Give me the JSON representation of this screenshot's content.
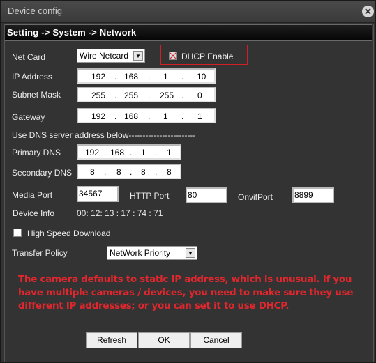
{
  "window": {
    "title": "Device config",
    "close_icon": "close-icon"
  },
  "breadcrumb": "Setting -> System -> Network",
  "net_card": {
    "label": "Net Card",
    "value": "Wire Netcard"
  },
  "dhcp": {
    "label": "DHCP Enable",
    "checked": false
  },
  "ip_address": {
    "label": "IP Address",
    "octets": [
      "192",
      "168",
      "1",
      "10"
    ]
  },
  "subnet_mask": {
    "label": "Subnet Mask",
    "octets": [
      "255",
      "255",
      "255",
      "0"
    ]
  },
  "gateway": {
    "label": "Gateway",
    "octets": [
      "192",
      "168",
      "1",
      "1"
    ]
  },
  "dns_header": "Use DNS server address below------------------------",
  "primary_dns": {
    "label": "Primary DNS",
    "octets": [
      "192",
      "168",
      "1",
      "1"
    ]
  },
  "secondary_dns": {
    "label": "Secondary DNS",
    "octets": [
      "8",
      "8",
      "8",
      "8"
    ]
  },
  "media_port": {
    "label": "Media Port",
    "value": "34567"
  },
  "http_port": {
    "label": "HTTP Port",
    "value": "80"
  },
  "onvif_port": {
    "label": "OnvifPort",
    "value": "8899"
  },
  "device_info": {
    "label": "Device Info",
    "value": "00:  12:  13 :  17  :  74 :  71"
  },
  "high_speed": {
    "label": "High Speed Download",
    "checked": false
  },
  "transfer_policy": {
    "label": "Transfer Policy",
    "value": "NetWork  Priority"
  },
  "note": "The camera defaults to static IP address, which is unusual. If you have multiple cameras / devices, you need to make sure they use different IP addresses; or you can set it to use DHCP.",
  "buttons": {
    "refresh": "Refresh",
    "ok": "OK",
    "cancel": "Cancel"
  },
  "colors": {
    "annotation": "#e0272d",
    "frame": "#d21f26",
    "background": "#333333"
  }
}
